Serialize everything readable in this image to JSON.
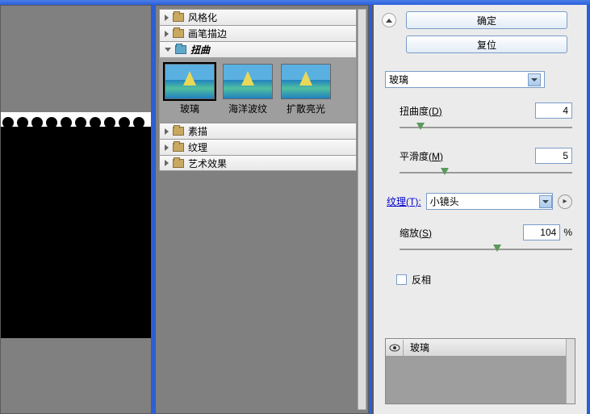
{
  "buttons": {
    "ok": "确定",
    "reset": "复位"
  },
  "categories": [
    {
      "label": "风格化",
      "open": false
    },
    {
      "label": "画笔描边",
      "open": false
    },
    {
      "label": "扭曲",
      "open": true,
      "selected": true
    },
    {
      "label": "素描",
      "open": false
    },
    {
      "label": "纹理",
      "open": false
    },
    {
      "label": "艺术效果",
      "open": false
    }
  ],
  "thumbnails": [
    {
      "label": "玻璃",
      "selected": true
    },
    {
      "label": "海洋波纹",
      "selected": false
    },
    {
      "label": "扩散亮光",
      "selected": false
    }
  ],
  "filter_selected": "玻璃",
  "params": {
    "distortion": {
      "label": "扭曲度",
      "key": "(D)",
      "value": "4",
      "pos": 10
    },
    "smoothness": {
      "label": "平滑度",
      "key": "(M)",
      "value": "5",
      "pos": 24
    },
    "texture": {
      "label": "纹理(T):",
      "value": "小镜头"
    },
    "scale": {
      "label": "缩放",
      "key": "(S)",
      "value": "104",
      "unit": "%",
      "pos": 54
    },
    "invert": {
      "label": "反相"
    }
  },
  "layer": {
    "name": "玻璃"
  }
}
